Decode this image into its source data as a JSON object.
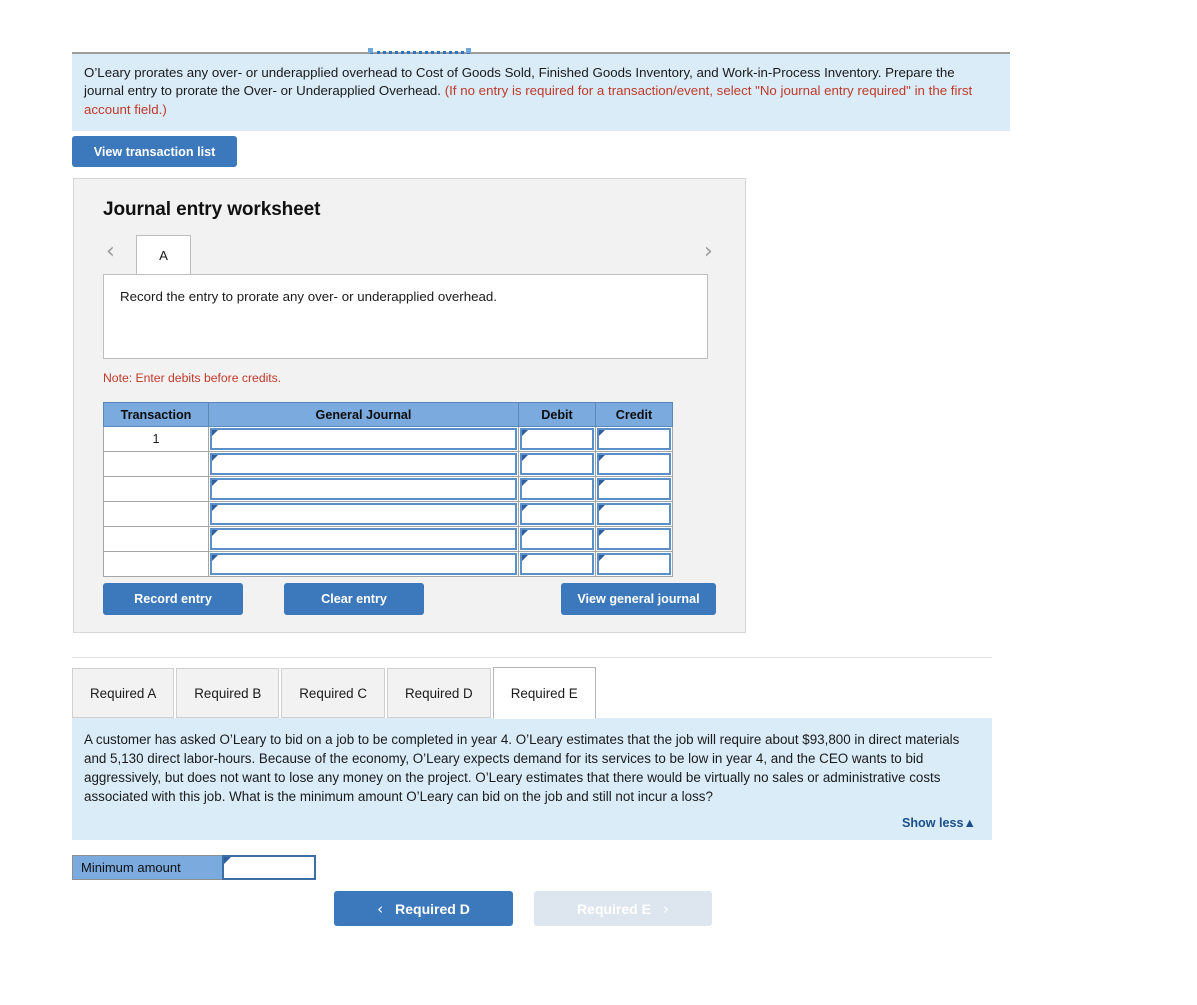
{
  "prompt": {
    "text_main": "O’Leary prorates any over- or underapplied overhead to Cost of Goods Sold, Finished Goods Inventory, and Work-in-Process Inventory. Prepare the journal entry to prorate the Over- or Underapplied Overhead. ",
    "text_red": "(If no entry is required for a transaction/event, select \"No journal entry required\" in the first account field.)"
  },
  "view_transaction_list_label": "View transaction list",
  "worksheet": {
    "title": "Journal entry worksheet",
    "nav_prev_icon": "chevron-left-icon",
    "nav_next_icon": "chevron-right-icon",
    "nav_prev_glyph": "‹",
    "nav_next_glyph": "›",
    "tab_label": "A",
    "description": "Record the entry to prorate any over- or underapplied overhead.",
    "note": "Note: Enter debits before credits.",
    "table": {
      "headers": [
        "Transaction",
        "General Journal",
        "Debit",
        "Credit"
      ],
      "rows": [
        {
          "transaction": "1",
          "general_journal": "",
          "debit": "",
          "credit": ""
        },
        {
          "transaction": "",
          "general_journal": "",
          "debit": "",
          "credit": ""
        },
        {
          "transaction": "",
          "general_journal": "",
          "debit": "",
          "credit": ""
        },
        {
          "transaction": "",
          "general_journal": "",
          "debit": "",
          "credit": ""
        },
        {
          "transaction": "",
          "general_journal": "",
          "debit": "",
          "credit": ""
        },
        {
          "transaction": "",
          "general_journal": "",
          "debit": "",
          "credit": ""
        }
      ]
    },
    "buttons": {
      "record_entry": "Record entry",
      "clear_entry": "Clear entry",
      "view_general_journal": "View general journal"
    }
  },
  "required_tabs": [
    {
      "label": "Required A",
      "active": false
    },
    {
      "label": "Required B",
      "active": false
    },
    {
      "label": "Required C",
      "active": false
    },
    {
      "label": "Required D",
      "active": false
    },
    {
      "label": "Required E",
      "active": true
    }
  ],
  "question": {
    "text": "A customer has asked O’Leary to bid on a job to be completed in year 4. O’Leary estimates that the job will require about $93,800 in direct materials and 5,130 direct labor-hours. Because of the economy, O’Leary expects demand for its services to be low in year 4, and the CEO wants to bid aggressively, but does not want to lose any money on the project. O’Leary estimates that there would be virtually no sales or administrative costs associated with this job. What is the minimum amount O’Leary can bid on the job and still not incur a loss?",
    "show_less_label": "Show less▲"
  },
  "answer_row": {
    "label": "Minimum amount",
    "value": "",
    "placeholder": ""
  },
  "bottom_nav": {
    "prev_label": "Required D",
    "next_label": "Required E",
    "prev_icon_glyph": "‹",
    "next_icon_glyph": "›"
  },
  "colors": {
    "accent_blue": "#3c78bc",
    "info_panel_bg": "#daecf8",
    "table_header_bg": "#7aaade",
    "red_text": "#c0392b",
    "panel_bg": "#f2f2f2"
  }
}
